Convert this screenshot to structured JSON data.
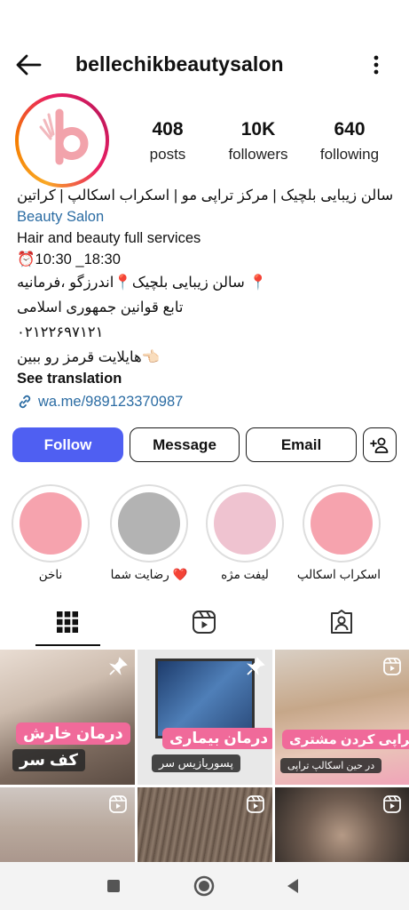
{
  "profile": {
    "username": "bellechikbeautysalon",
    "avatar_letter": "b"
  },
  "stats": [
    {
      "value": "408",
      "label": "posts"
    },
    {
      "value": "10K",
      "label": "followers"
    },
    {
      "value": "640",
      "label": "following"
    }
  ],
  "bio": {
    "line1": "سالن زیبایی بلچیک | مرکز تراپی مو | اسکراب اسکالپ | کراتین",
    "category": "Beauty Salon",
    "line3": "Hair and beauty full services",
    "hours": "⏰10:30 _18:30",
    "address": "📍 سالن زیبایی بلچیک📍اندرزگو ،فرمانیه",
    "law": "تابع قوانین جمهوری اسلامی",
    "phone": "۰۲۱۲۲۶۹۷۱۲۱",
    "highlight_note": "👈🏻هایلایت قرمز رو ببین",
    "see_translation": "See translation",
    "link": "wa.me/989123370987"
  },
  "buttons": {
    "follow": "Follow",
    "message": "Message",
    "email": "Email"
  },
  "highlights": [
    {
      "label": "ناخن",
      "color": "#f6a3ae"
    },
    {
      "label": "❤️ رضایت شما",
      "color": "#b3b3b3"
    },
    {
      "label": "لیفت مژه",
      "color": "#efc3d0"
    },
    {
      "label": "اسکراب اسکالپ",
      "color": "#f6a3ae"
    }
  ],
  "tabs": [
    "grid-icon",
    "reels-icon",
    "tagged-icon"
  ],
  "posts": [
    {
      "title": "درمان خارش",
      "subtitle": "کف سر",
      "accent": "#f06a9a"
    },
    {
      "title": "درمان بیماری",
      "subtitle": "پسوریازیس سر",
      "accent": "#f06a9a"
    },
    {
      "title": "تراپی کردن مشتری",
      "subtitle": "در حین اسکالپ تراپی",
      "accent": "#f06a9a"
    }
  ],
  "colors": {
    "accent": "#4f5ff2",
    "link": "#2b6ca3"
  }
}
